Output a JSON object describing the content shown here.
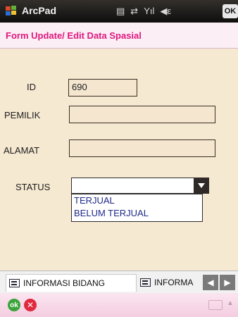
{
  "titlebar": {
    "app_title": "ArcPad",
    "ok_label": "OK",
    "status_glyphs": [
      "▤",
      "⇄",
      "Yıl",
      "◀ε",
      "🔊"
    ]
  },
  "form": {
    "title": "Form Update/ Edit Data Spasial",
    "fields": {
      "id": {
        "label": "ID",
        "value": "690"
      },
      "pemilik": {
        "label": "PEMILIK",
        "value": ""
      },
      "alamat": {
        "label": "ALAMAT",
        "value": ""
      },
      "status": {
        "label": "STATUS",
        "value": "",
        "options": [
          "TERJUAL",
          "BELUM TERJUAL"
        ]
      }
    }
  },
  "tabs": {
    "items": [
      {
        "label": "INFORMASI BIDANG"
      },
      {
        "label": "INFORMA"
      }
    ]
  },
  "bottombar": {
    "ok_label": "ok",
    "cancel_label": "✕"
  },
  "colors": {
    "title_pink": "#e0197f",
    "background": "#f6e9d2",
    "titlebar": "#1a1918"
  }
}
